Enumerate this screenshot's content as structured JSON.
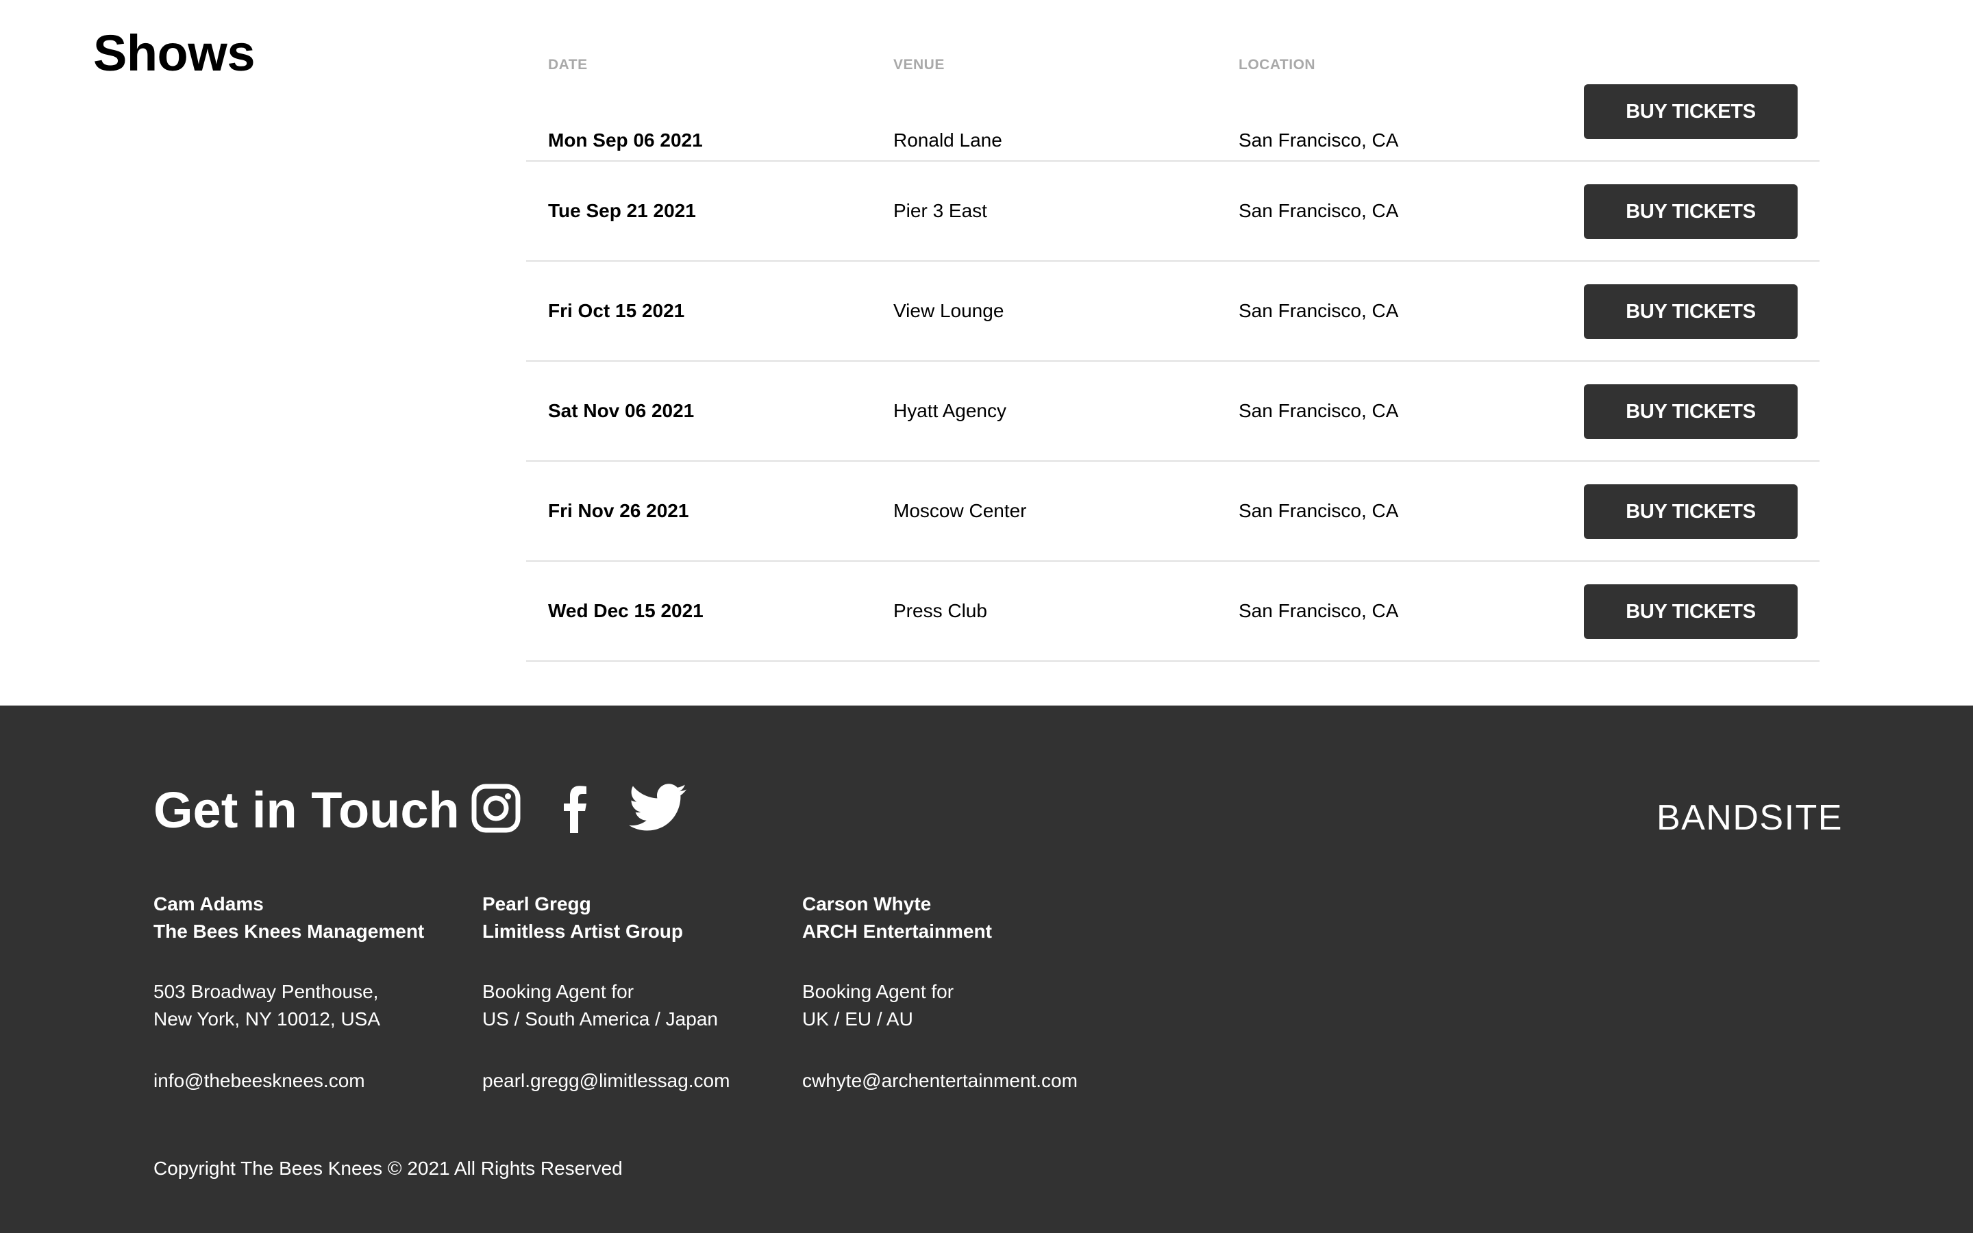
{
  "shows": {
    "title": "Shows",
    "columns": {
      "date": "DATE",
      "venue": "VENUE",
      "location": "LOCATION"
    },
    "rows": [
      {
        "date": "Mon Sep 06 2021",
        "venue": "Ronald Lane",
        "location": "San Francisco, CA",
        "button": "BUY TICKETS"
      },
      {
        "date": "Tue Sep 21 2021",
        "venue": "Pier 3 East",
        "location": "San Francisco, CA",
        "button": "BUY TICKETS"
      },
      {
        "date": "Fri Oct 15 2021",
        "venue": "View Lounge",
        "location": "San Francisco, CA",
        "button": "BUY TICKETS"
      },
      {
        "date": "Sat Nov 06 2021",
        "venue": "Hyatt Agency",
        "location": "San Francisco, CA",
        "button": "BUY TICKETS"
      },
      {
        "date": "Fri Nov 26 2021",
        "venue": "Moscow Center",
        "location": "San Francisco, CA",
        "button": "BUY TICKETS"
      },
      {
        "date": "Wed Dec 15 2021",
        "venue": "Press Club",
        "location": "San Francisco, CA",
        "button": "BUY TICKETS"
      }
    ]
  },
  "footer": {
    "title": "Get in Touch",
    "brand": "BANDSITE",
    "social": [
      "instagram-icon",
      "facebook-icon",
      "twitter-icon"
    ],
    "contacts": [
      {
        "name": "Cam Adams",
        "org": "The Bees Knees Management",
        "line1": "503 Broadway Penthouse,",
        "line2": "New York, NY 10012, USA",
        "email": "info@thebeesknees.com"
      },
      {
        "name": "Pearl Gregg",
        "org": "Limitless Artist Group",
        "line1": "Booking Agent for",
        "line2": "US / South America / Japan",
        "email": "pearl.gregg@limitlessag.com"
      },
      {
        "name": "Carson Whyte",
        "org": "ARCH Entertainment",
        "line1": "Booking Agent for",
        "line2": "UK / EU / AU",
        "email": "cwhyte@archentertainment.com"
      }
    ],
    "copyright": "Copyright The Bees Knees © 2021 All Rights Reserved"
  },
  "colors": {
    "footer_bg": "#323232",
    "button_bg": "#323232",
    "header_gray": "#a9a9a9",
    "divider": "#e1e1e1"
  }
}
